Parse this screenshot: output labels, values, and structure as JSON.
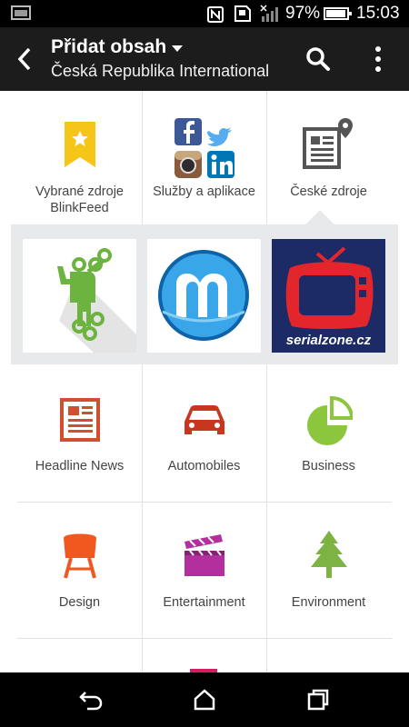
{
  "status_bar": {
    "battery_percent": "97%",
    "battery_level": 0.97,
    "time": "15:03",
    "icons": [
      "gallery-notification-icon",
      "nfc-icon",
      "sd-card-icon",
      "signal-icon",
      "battery-icon"
    ]
  },
  "app_bar": {
    "title": "Přidat obsah",
    "subtitle": "Česká Republika International",
    "icons": [
      "back-arrow-icon",
      "dropdown-caret-icon",
      "search-icon",
      "overflow-menu-icon"
    ]
  },
  "categories_top": [
    {
      "label": "Vybrané zdroje BlinkFeed",
      "icon": "bookmark-star-icon",
      "color": "#f5c518"
    },
    {
      "label": "Služby a aplikace",
      "icon": "social-services-icon"
    },
    {
      "label": "České zdroje",
      "icon": "local-news-icon",
      "color": "#555555"
    }
  ],
  "featured_sources": [
    {
      "icon": "android-green-figure-icon",
      "color": "#6db33f"
    },
    {
      "icon": "m-logo-icon",
      "color": "#1e88d6"
    },
    {
      "icon": "serialzone-tv-icon",
      "caption": "serialzone.cz",
      "color": "#e2262b"
    }
  ],
  "categories_grid": [
    {
      "label": "Headline News",
      "icon": "newspaper-icon",
      "color": "#d24e30"
    },
    {
      "label": "Automobiles",
      "icon": "car-icon",
      "color": "#c8361f"
    },
    {
      "label": "Business",
      "icon": "pie-chart-icon",
      "color": "#8cc63f"
    },
    {
      "label": "Design",
      "icon": "chair-icon",
      "color": "#f0581f"
    },
    {
      "label": "Entertainment",
      "icon": "clapperboard-icon",
      "color": "#b42f9e"
    },
    {
      "label": "Environment",
      "icon": "tree-icon",
      "color": "#7cb342"
    }
  ],
  "nav_bar": {
    "icons": [
      "nav-back-icon",
      "nav-home-icon",
      "nav-recents-icon"
    ]
  }
}
